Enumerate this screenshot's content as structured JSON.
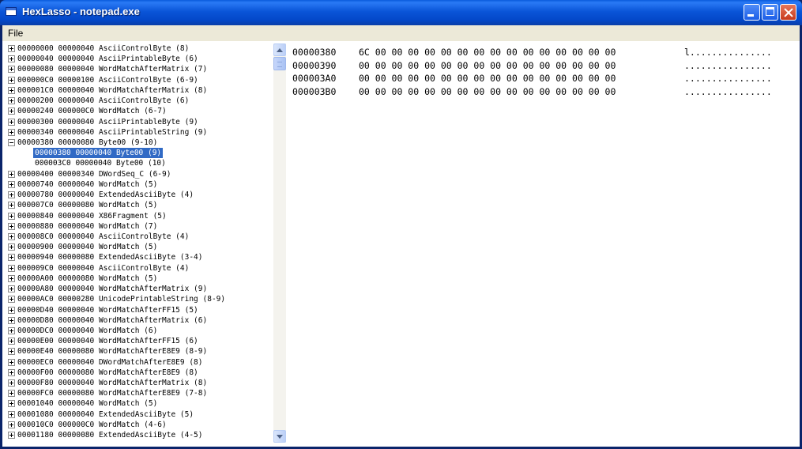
{
  "window": {
    "title": "HexLasso - notepad.exe",
    "icon": "app-window-icon",
    "controls": [
      "minimize-icon",
      "maximize-icon",
      "close-icon"
    ]
  },
  "menu": {
    "file": "File"
  },
  "tree": {
    "rows": [
      {
        "text": "00000000 00000040 AsciiControlByte (8)",
        "expander": "plus"
      },
      {
        "text": "00000040 00000040 AsciiPrintableByte (6)",
        "expander": "plus"
      },
      {
        "text": "00000080 00000040 WordMatchAfterMatrix (7)",
        "expander": "plus"
      },
      {
        "text": "000000C0 00000100 AsciiControlByte (6-9)",
        "expander": "plus"
      },
      {
        "text": "000001C0 00000040 WordMatchAfterMatrix (8)",
        "expander": "plus"
      },
      {
        "text": "00000200 00000040 AsciiControlByte (6)",
        "expander": "plus"
      },
      {
        "text": "00000240 000000C0 WordMatch (6-7)",
        "expander": "plus"
      },
      {
        "text": "00000300 00000040 AsciiPrintableByte (9)",
        "expander": "plus"
      },
      {
        "text": "00000340 00000040 AsciiPrintableString (9)",
        "expander": "plus"
      },
      {
        "text": "00000380 00000080 Byte00 (9-10)",
        "expander": "minus"
      },
      {
        "text": "00000380 00000040 Byte00 (9)",
        "expander": "none",
        "child": true,
        "selected": true
      },
      {
        "text": "000003C0 00000040 Byte00 (10)",
        "expander": "none",
        "child": true
      },
      {
        "text": "00000400 00000340 DWordSeq_C (6-9)",
        "expander": "plus"
      },
      {
        "text": "00000740 00000040 WordMatch (5)",
        "expander": "plus"
      },
      {
        "text": "00000780 00000040 ExtendedAsciiByte (4)",
        "expander": "plus"
      },
      {
        "text": "000007C0 00000080 WordMatch (5)",
        "expander": "plus"
      },
      {
        "text": "00000840 00000040 X86Fragment (5)",
        "expander": "plus"
      },
      {
        "text": "00000880 00000040 WordMatch (7)",
        "expander": "plus"
      },
      {
        "text": "000008C0 00000040 AsciiControlByte (4)",
        "expander": "plus"
      },
      {
        "text": "00000900 00000040 WordMatch (5)",
        "expander": "plus"
      },
      {
        "text": "00000940 00000080 ExtendedAsciiByte (3-4)",
        "expander": "plus"
      },
      {
        "text": "000009C0 00000040 AsciiControlByte (4)",
        "expander": "plus"
      },
      {
        "text": "00000A00 00000080 WordMatch (5)",
        "expander": "plus"
      },
      {
        "text": "00000A80 00000040 WordMatchAfterMatrix (9)",
        "expander": "plus"
      },
      {
        "text": "00000AC0 00000280 UnicodePrintableString (8-9)",
        "expander": "plus"
      },
      {
        "text": "00000D40 00000040 WordMatchAfterFF15 (5)",
        "expander": "plus"
      },
      {
        "text": "00000D80 00000040 WordMatchAfterMatrix (6)",
        "expander": "plus"
      },
      {
        "text": "00000DC0 00000040 WordMatch (6)",
        "expander": "plus"
      },
      {
        "text": "00000E00 00000040 WordMatchAfterFF15 (6)",
        "expander": "plus"
      },
      {
        "text": "00000E40 00000080 WordMatchAfterE8E9 (8-9)",
        "expander": "plus"
      },
      {
        "text": "00000EC0 00000040 DWordMatchAfterE8E9 (8)",
        "expander": "plus"
      },
      {
        "text": "00000F00 00000080 WordMatchAfterE8E9 (8)",
        "expander": "plus"
      },
      {
        "text": "00000F80 00000040 WordMatchAfterMatrix (8)",
        "expander": "plus"
      },
      {
        "text": "00000FC0 00000080 WordMatchAfterE8E9 (7-8)",
        "expander": "plus"
      },
      {
        "text": "00001040 00000040 WordMatch (5)",
        "expander": "plus"
      },
      {
        "text": "00001080 00000040 ExtendedAsciiByte (5)",
        "expander": "plus"
      },
      {
        "text": "000010C0 000000C0 WordMatch (4-6)",
        "expander": "plus"
      },
      {
        "text": "00001180 00000080 ExtendedAsciiByte (4-5)",
        "expander": "plus"
      }
    ]
  },
  "hex": {
    "rows": [
      {
        "address": "00000380",
        "bytes": "6C 00 00 00 00 00 00 00 00 00 00 00 00 00 00 00",
        "ascii": "l..............."
      },
      {
        "address": "00000390",
        "bytes": "00 00 00 00 00 00 00 00 00 00 00 00 00 00 00 00",
        "ascii": "................"
      },
      {
        "address": "000003A0",
        "bytes": "00 00 00 00 00 00 00 00 00 00 00 00 00 00 00 00",
        "ascii": "................"
      },
      {
        "address": "000003B0",
        "bytes": "00 00 00 00 00 00 00 00 00 00 00 00 00 00 00 00",
        "ascii": "................"
      }
    ]
  }
}
